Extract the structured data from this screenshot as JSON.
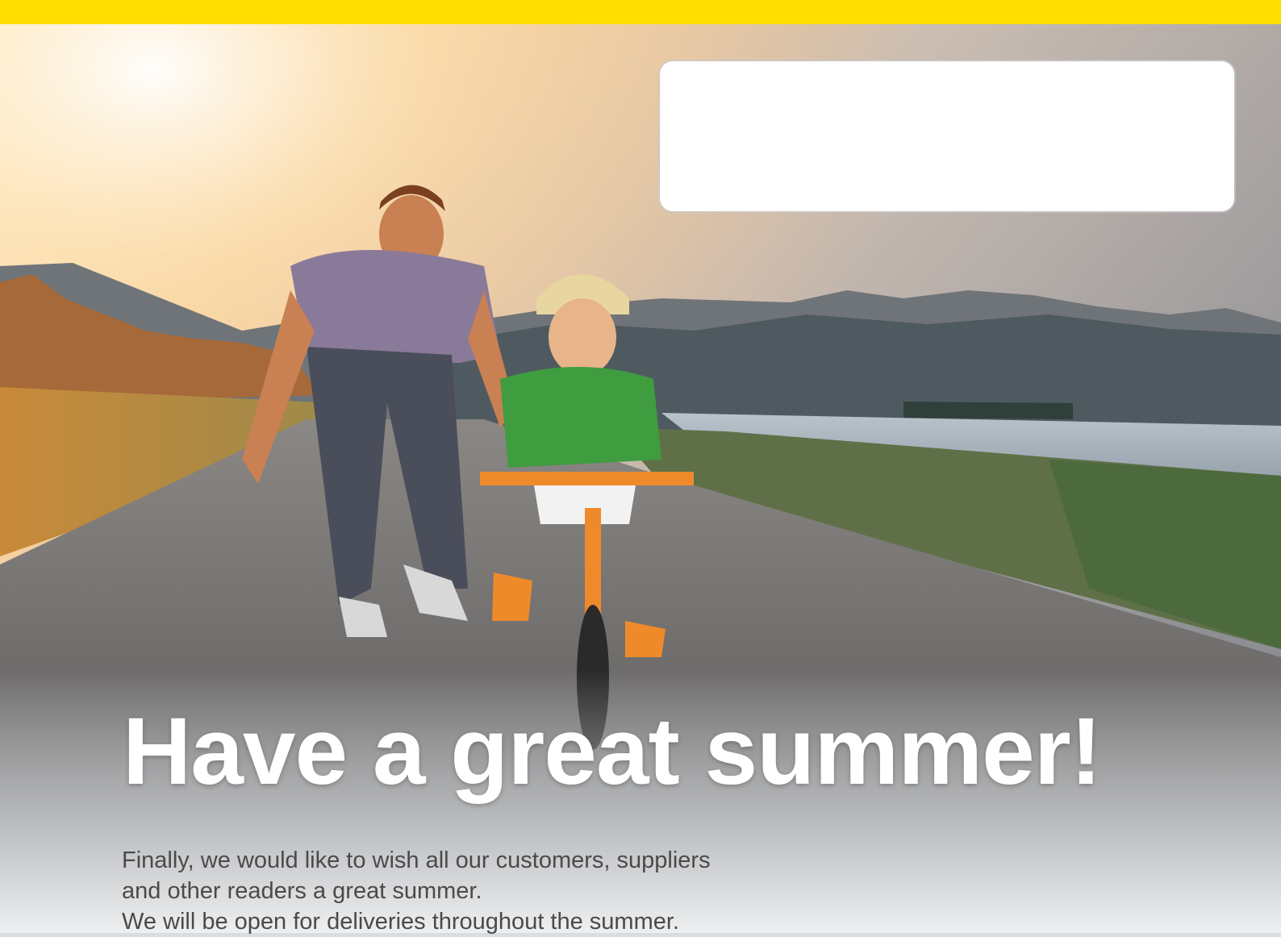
{
  "headline": "Have a great summer!",
  "body": {
    "line_1": "Finally, we would like to wish all our customers, suppliers",
    "line_2": "and other readers a great summer.",
    "line_3": "We will be open for deliveries throughout the summer."
  },
  "colors": {
    "top_bar": "#ffde00",
    "headline": "#ffffff",
    "body_text": "#4a4a4a",
    "address_box": "#ffffff"
  }
}
